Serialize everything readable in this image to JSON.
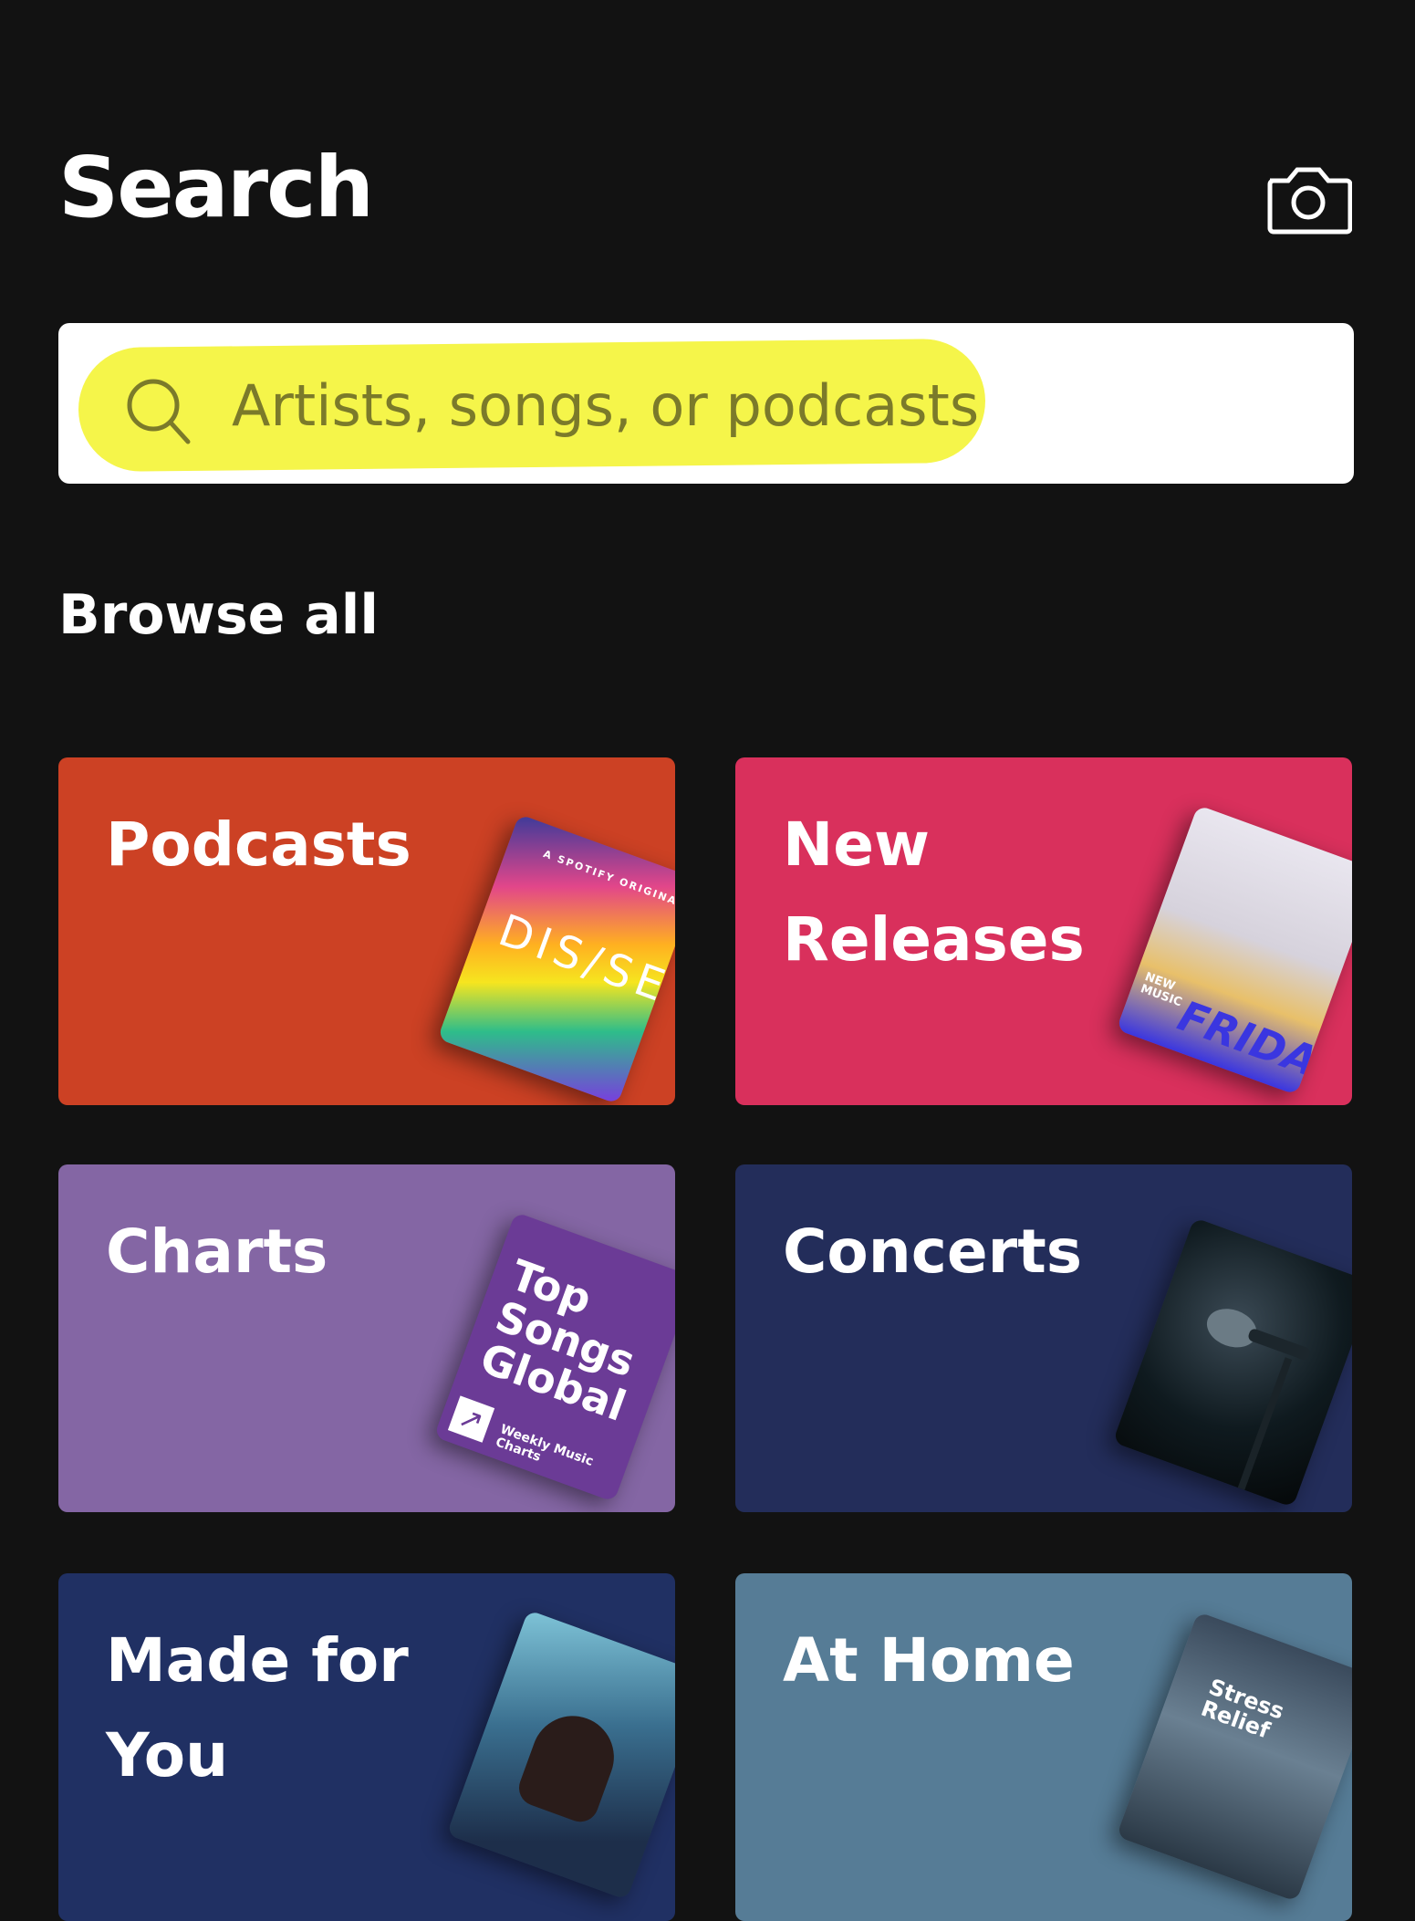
{
  "header": {
    "title": "Search",
    "camera_icon": "camera-icon"
  },
  "search": {
    "placeholder": "Artists, songs, or podcasts",
    "icon": "search-icon"
  },
  "browse": {
    "title": "Browse all",
    "tiles": [
      {
        "label": "Podcasts",
        "color": "#cc4124",
        "art_text": "DIS/SEC",
        "art_small": "A SPOTIFY ORIGINAL"
      },
      {
        "label": "New Releases",
        "color": "#d9305c",
        "art_text": "FRIDAY",
        "art_small": "NEW MUSIC"
      },
      {
        "label": "Charts",
        "color": "#8466a4",
        "art_text": "Top Songs Global",
        "art_small": "Weekly Music Charts"
      },
      {
        "label": "Concerts",
        "color": "#232d5a"
      },
      {
        "label": "Made for You",
        "color": "#203063"
      },
      {
        "label": "At Home",
        "color": "#567c96",
        "art_text": "Stress Relief"
      }
    ]
  }
}
